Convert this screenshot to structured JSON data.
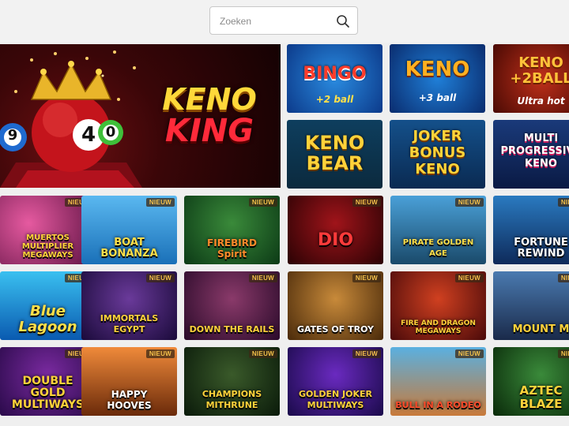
{
  "search": {
    "placeholder": "Zoeken"
  },
  "hero": {
    "title_line1": "KENO",
    "title_line2": "KING",
    "balls": [
      "9",
      "4",
      "0"
    ],
    "active_slide": 2,
    "slide_count": 3
  },
  "colors": {
    "accent": "#ff8a1c",
    "badge_text": "#f4c04a"
  },
  "keno_tiles": [
    {
      "name": "BINGO",
      "sub": "+2 ball"
    },
    {
      "name": "KENO",
      "sub": "+3 ball"
    },
    {
      "name": "KENO\n+2BALL",
      "sub": "Ultra hot"
    },
    {
      "name": "KENO\nBEAR",
      "sub": ""
    },
    {
      "name": "JOKER\nBONUS\nKENO",
      "sub": ""
    },
    {
      "name": "MULTI\nPROGRESSIVE\nKENO",
      "sub": ""
    }
  ],
  "game_rows": [
    [
      {
        "name": "MUERTOS MULTIPLIER\nMEGAWAYS",
        "badge": "NIEUW"
      },
      {
        "name": "BOAT\nBONANZA",
        "badge": "NIEUW"
      },
      {
        "name": "FIREBIRD\nSpirit",
        "badge": "NIEUW"
      },
      {
        "name": "DIO",
        "badge": "NIEUW"
      },
      {
        "name": "PIRATE GOLDEN AGE",
        "badge": "NIEUW"
      },
      {
        "name": "FORTUNE\nREWIND",
        "badge": "NIEUW"
      }
    ],
    [
      {
        "name": "Blue\nLagoon",
        "badge": "NIEUW"
      },
      {
        "name": "IMMORTALS\nEGYPT",
        "badge": "NIEUW"
      },
      {
        "name": "DOWN THE RAILS",
        "badge": "NIEUW"
      },
      {
        "name": "GATES OF TROY",
        "badge": "NIEUW"
      },
      {
        "name": "FIRE AND DRAGON\nMEGAWAYS",
        "badge": "NIEUW"
      },
      {
        "name": "MOUNT M",
        "badge": "NIEUW"
      }
    ],
    [
      {
        "name": "DOUBLE\nGOLD\nMULTIWAYS",
        "badge": "NIEUW"
      },
      {
        "name": "HAPPY\nHOOVES",
        "badge": "NIEUW"
      },
      {
        "name": "CHAMPIONS\nMITHRUNE",
        "badge": "NIEUW"
      },
      {
        "name": "GOLDEN JOKER\nMULTIWAYS",
        "badge": "NIEUW"
      },
      {
        "name": "BULL IN A RODEO",
        "badge": "NIEUW"
      },
      {
        "name": "AZTEC\nBLAZE",
        "badge": "NIEUW"
      }
    ]
  ]
}
